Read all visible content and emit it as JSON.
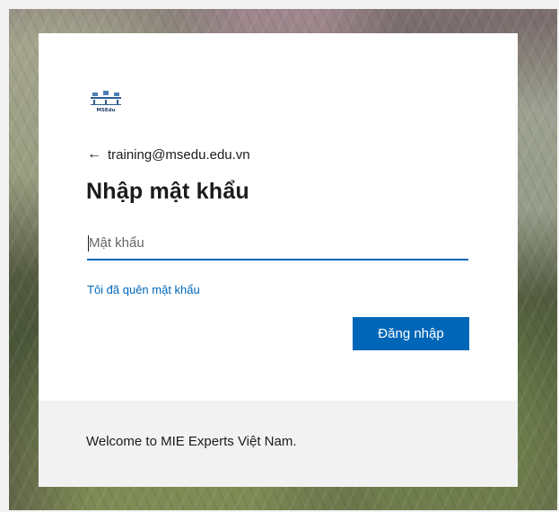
{
  "signin": {
    "logo_text": "MSEdu",
    "account_email": "training@msedu.edu.vn",
    "back_icon": "arrow-left-icon",
    "title": "Nhập mật khẩu",
    "password": {
      "placeholder": "Mật khẩu",
      "value": ""
    },
    "forgot_link": "Tôi đã quên mật khẩu",
    "submit_label": "Đăng nhập",
    "footer_text": "Welcome to MIE Experts Việt Nam."
  },
  "colors": {
    "accent": "#0067b8",
    "card": "#ffffff",
    "footer": "#f2f2f2",
    "text": "#1b1b1b"
  }
}
